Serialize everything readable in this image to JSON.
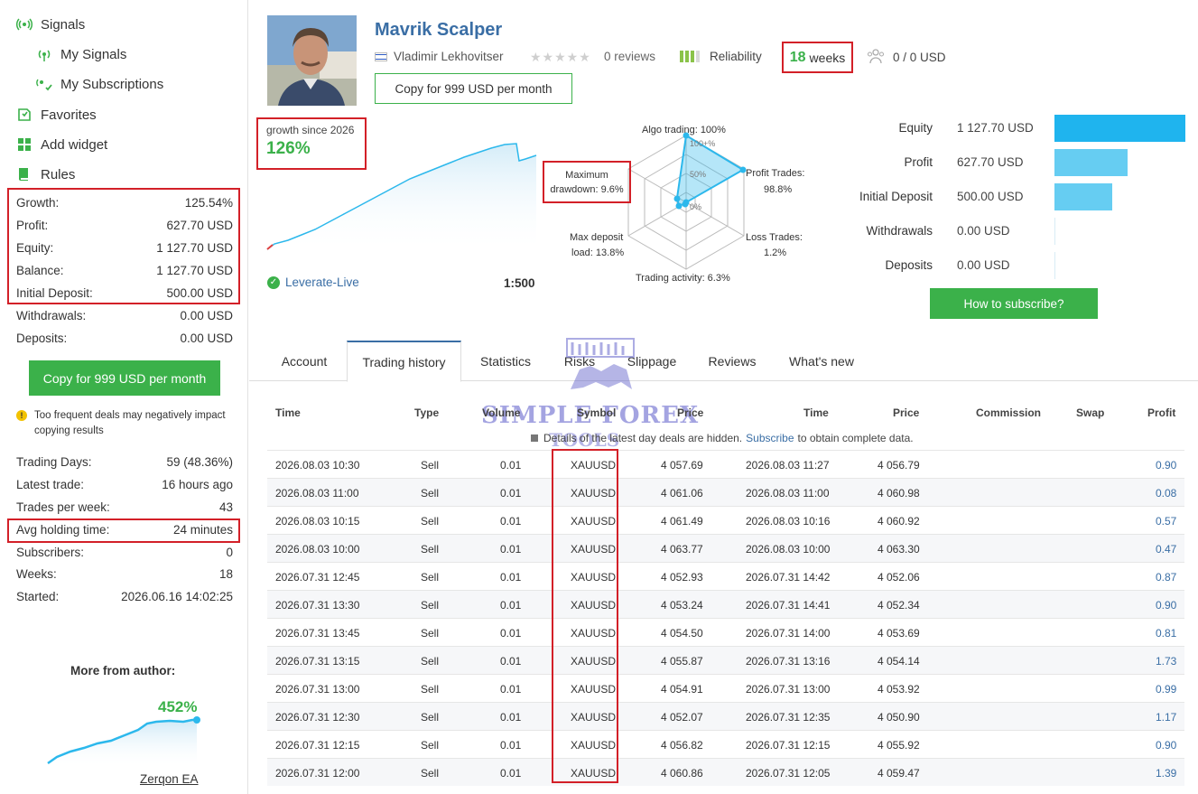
{
  "nav": {
    "signals": "Signals",
    "my_signals": "My Signals",
    "my_subscriptions": "My Subscriptions",
    "favorites": "Favorites",
    "add_widget": "Add widget",
    "rules": "Rules"
  },
  "stats": [
    {
      "label": "Growth:",
      "value": "125.54%"
    },
    {
      "label": "Profit:",
      "value": "627.70 USD"
    },
    {
      "label": "Equity:",
      "value": "1 127.70 USD"
    },
    {
      "label": "Balance:",
      "value": "1 127.70 USD"
    },
    {
      "label": "Initial Deposit:",
      "value": "500.00 USD"
    },
    {
      "label": "Withdrawals:",
      "value": "0.00 USD"
    },
    {
      "label": "Deposits:",
      "value": "0.00 USD"
    }
  ],
  "sidebar_copy_button": "Copy for 999 USD per month",
  "warning_note": "Too frequent deals may negatively impact copying results",
  "stats2": [
    {
      "label": "Trading Days:",
      "value": "59 (48.36%)"
    },
    {
      "label": "Latest trade:",
      "value": "16 hours ago"
    },
    {
      "label": "Trades per week:",
      "value": "43"
    },
    {
      "label": "Avg holding time:",
      "value": "24 minutes"
    },
    {
      "label": "Subscribers:",
      "value": "0"
    },
    {
      "label": "Weeks:",
      "value": "18"
    },
    {
      "label": "Started:",
      "value": "2026.06.16 14:02:25"
    }
  ],
  "more_from_author": {
    "title": "More from author:",
    "growth": "452%",
    "name": "Zerqon EA"
  },
  "signal": {
    "title": "Mavrik Scalper",
    "author": "Vladimir Lekhovitser",
    "reviews": "0 reviews",
    "reliability": "Reliability",
    "weeks_num": "18",
    "weeks_word": "weeks",
    "subscribers_funds": "0 / 0 USD",
    "copy_button": "Copy for 999 USD per month"
  },
  "growth_box": {
    "label": "growth since 2026",
    "value": "126%"
  },
  "broker": "Leverate-Live",
  "leverage": "1:500",
  "radar": {
    "algo": "Algo trading: 100%",
    "profit_trades_1": "Profit Trades:",
    "profit_trades_2": "98.8%",
    "loss_trades_1": "Loss Trades:",
    "loss_trades_2": "1.2%",
    "activity": "Trading activity: 6.3%",
    "deposit_load_1": "Max deposit",
    "deposit_load_2": "load: 13.8%",
    "drawdown_1": "Maximum",
    "drawdown_2": "drawdown: 9.6%",
    "ring_100": "100+%",
    "ring_50": "50%",
    "ring_0": "0%",
    "values": {
      "algo": 100,
      "profit": 98.8,
      "loss": 1.2,
      "activity": 6.3,
      "deposit_load": 13.8,
      "drawdown": 9.6
    }
  },
  "metrics": [
    {
      "label": "Equity",
      "value": "1 127.70 USD",
      "amount": 1127.7
    },
    {
      "label": "Profit",
      "value": "627.70 USD",
      "amount": 627.7
    },
    {
      "label": "Initial Deposit",
      "value": "500.00 USD",
      "amount": 500.0
    },
    {
      "label": "Withdrawals",
      "value": "0.00 USD",
      "amount": 0
    },
    {
      "label": "Deposits",
      "value": "0.00 USD",
      "amount": 0
    }
  ],
  "how_to_subscribe": "How to subscribe?",
  "tabs": [
    "Account",
    "Trading history",
    "Statistics",
    "Risks",
    "Slippage",
    "Reviews",
    "What's new"
  ],
  "table_headers": [
    "Time",
    "Type",
    "Volume",
    "Symbol",
    "Price",
    "Time",
    "Price",
    "Commission",
    "Swap",
    "Profit"
  ],
  "hidden_note": {
    "pre": "Details of the latest day deals are hidden.",
    "link": "Subscribe",
    "post": "to obtain complete data."
  },
  "watermark": {
    "line1": "SIMPLE FOREX",
    "line2": "TOOLS"
  },
  "trades": [
    [
      "2026.08.03 10:30",
      "Sell",
      "0.01",
      "XAUUSD.",
      "4 057.69",
      "2026.08.03 11:27",
      "4 056.79",
      "0.90"
    ],
    [
      "2026.08.03 11:00",
      "Sell",
      "0.01",
      "XAUUSD.",
      "4 061.06",
      "2026.08.03 11:00",
      "4 060.98",
      "0.08"
    ],
    [
      "2026.08.03 10:15",
      "Sell",
      "0.01",
      "XAUUSD.",
      "4 061.49",
      "2026.08.03 10:16",
      "4 060.92",
      "0.57"
    ],
    [
      "2026.08.03 10:00",
      "Sell",
      "0.01",
      "XAUUSD.",
      "4 063.77",
      "2026.08.03 10:00",
      "4 063.30",
      "0.47"
    ],
    [
      "2026.07.31 12:45",
      "Sell",
      "0.01",
      "XAUUSD.",
      "4 052.93",
      "2026.07.31 14:42",
      "4 052.06",
      "0.87"
    ],
    [
      "2026.07.31 13:30",
      "Sell",
      "0.01",
      "XAUUSD.",
      "4 053.24",
      "2026.07.31 14:41",
      "4 052.34",
      "0.90"
    ],
    [
      "2026.07.31 13:45",
      "Sell",
      "0.01",
      "XAUUSD.",
      "4 054.50",
      "2026.07.31 14:00",
      "4 053.69",
      "0.81"
    ],
    [
      "2026.07.31 13:15",
      "Sell",
      "0.01",
      "XAUUSD.",
      "4 055.87",
      "2026.07.31 13:16",
      "4 054.14",
      "1.73"
    ],
    [
      "2026.07.31 13:00",
      "Sell",
      "0.01",
      "XAUUSD.",
      "4 054.91",
      "2026.07.31 13:00",
      "4 053.92",
      "0.99"
    ],
    [
      "2026.07.31 12:30",
      "Sell",
      "0.01",
      "XAUUSD.",
      "4 052.07",
      "2026.07.31 12:35",
      "4 050.90",
      "1.17"
    ],
    [
      "2026.07.31 12:15",
      "Sell",
      "0.01",
      "XAUUSD.",
      "4 056.82",
      "2026.07.31 12:15",
      "4 055.92",
      "0.90"
    ],
    [
      "2026.07.31 12:00",
      "Sell",
      "0.01",
      "XAUUSD.",
      "4 060.86",
      "2026.07.31 12:05",
      "4 059.47",
      "1.39"
    ]
  ],
  "colors": {
    "accent": "#3bb14a",
    "link": "#3a6ea5",
    "highlight": "#d32028",
    "bar": "#2cb8ec"
  }
}
